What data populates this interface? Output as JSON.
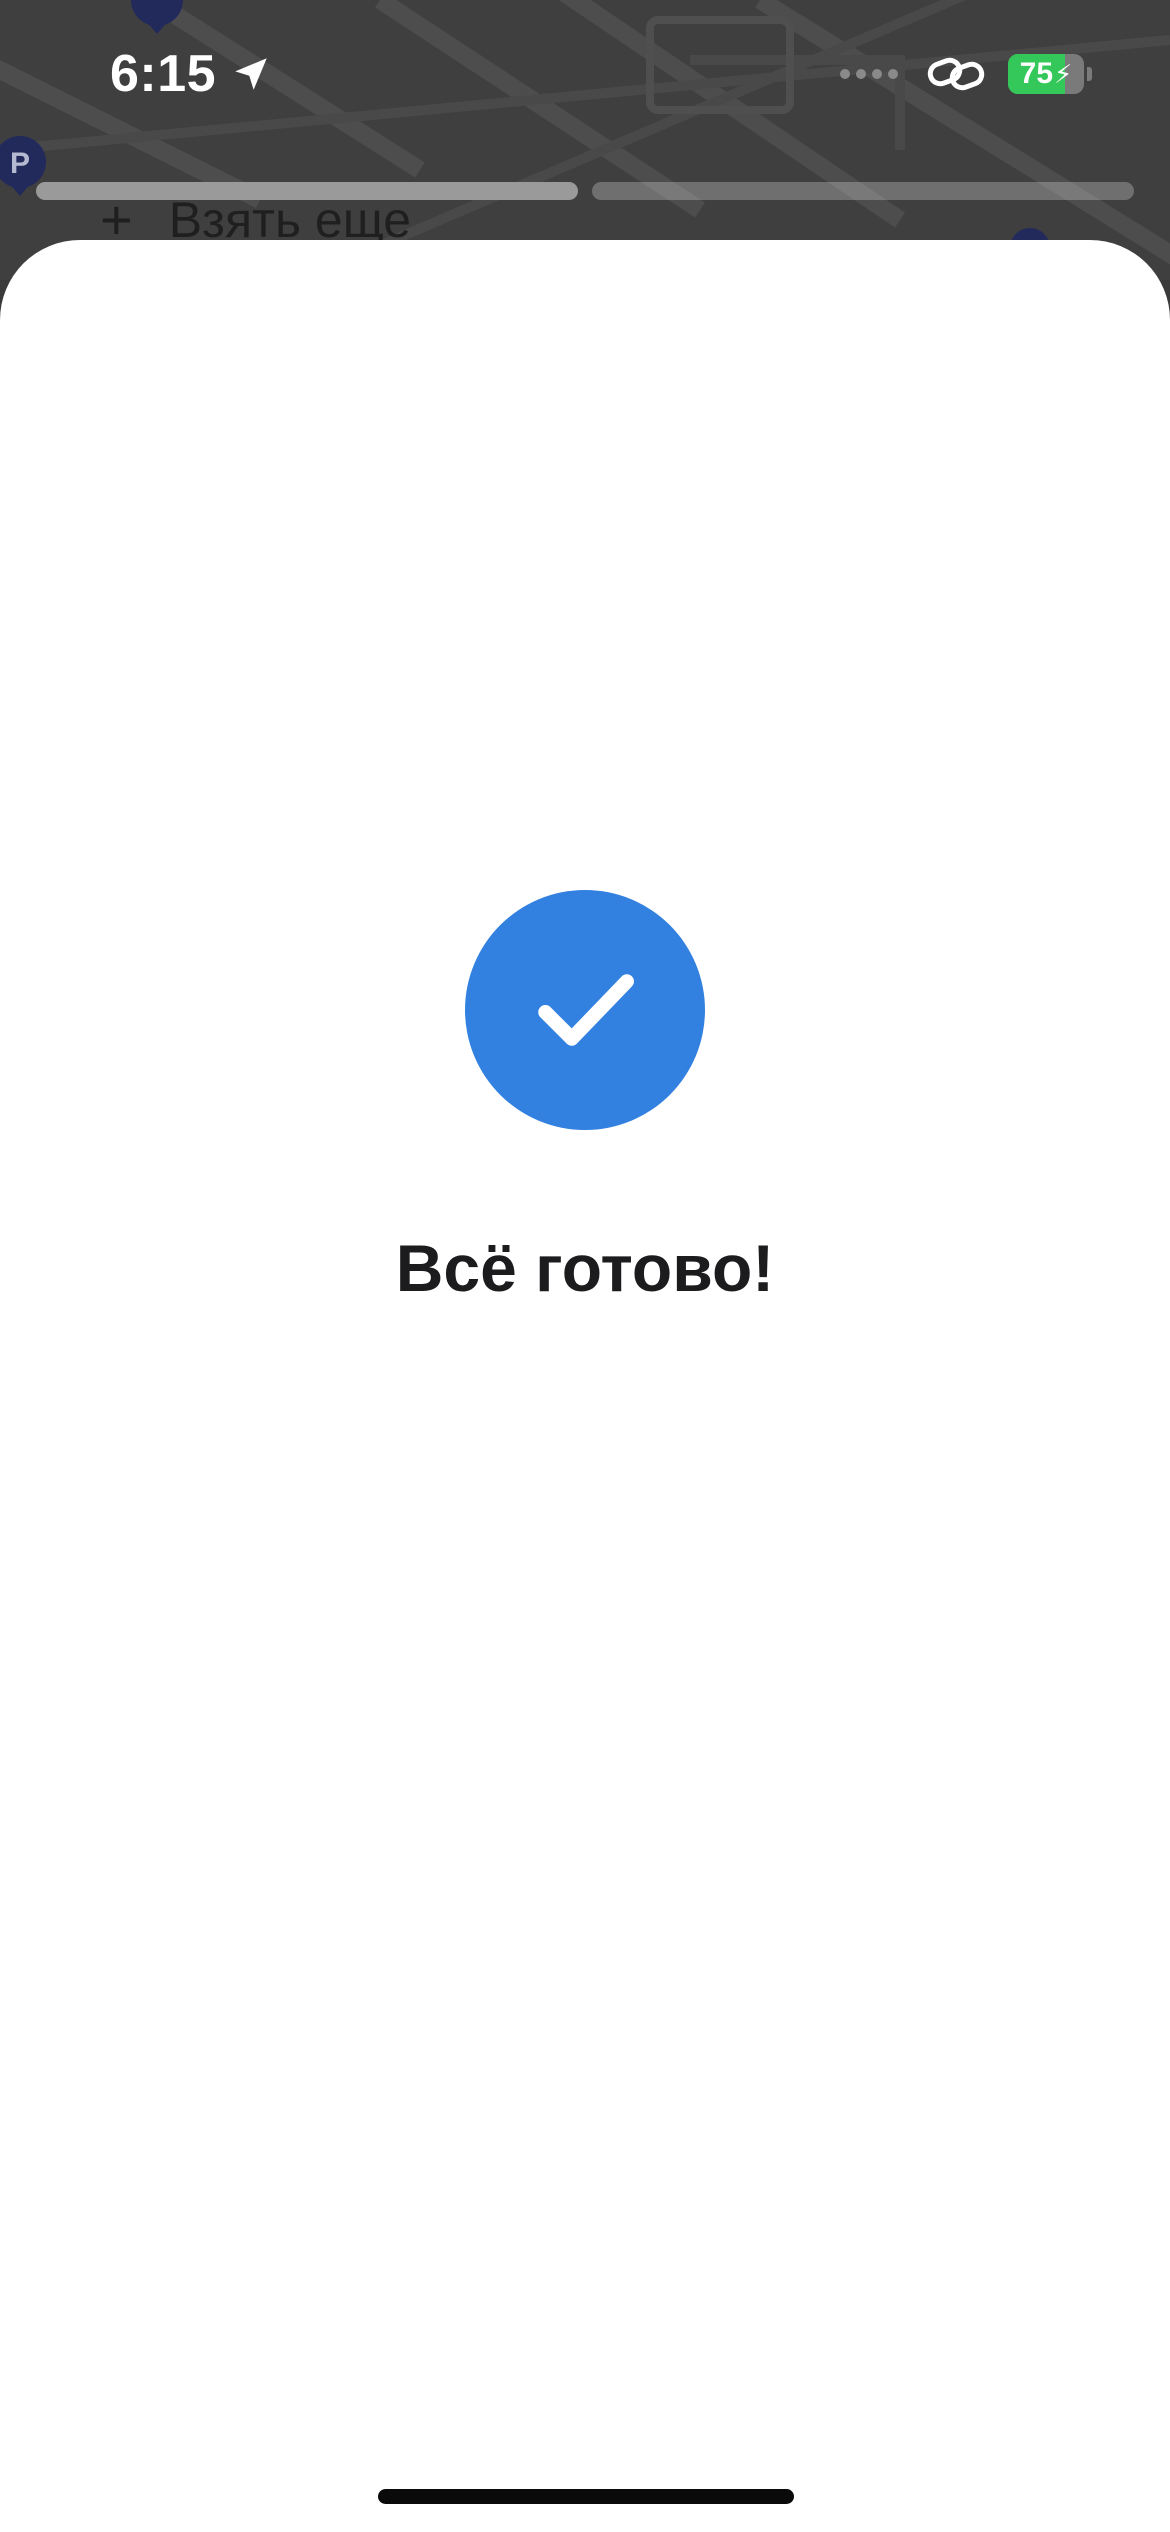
{
  "status_bar": {
    "time": "6:15",
    "location_icon": "location-arrow-icon",
    "link_icon": "link-icon",
    "battery_level": "75",
    "battery_fraction": 0.75,
    "battery_color": "#34c759"
  },
  "story_progress": {
    "segments": [
      1.0,
      0.0
    ]
  },
  "background": {
    "take_more_label": "Взять еще",
    "plus_icon": "plus-icon"
  },
  "sheet": {
    "success_icon": "checkmark-icon",
    "success_color": "#3281e0",
    "title": "Всё готово!"
  }
}
